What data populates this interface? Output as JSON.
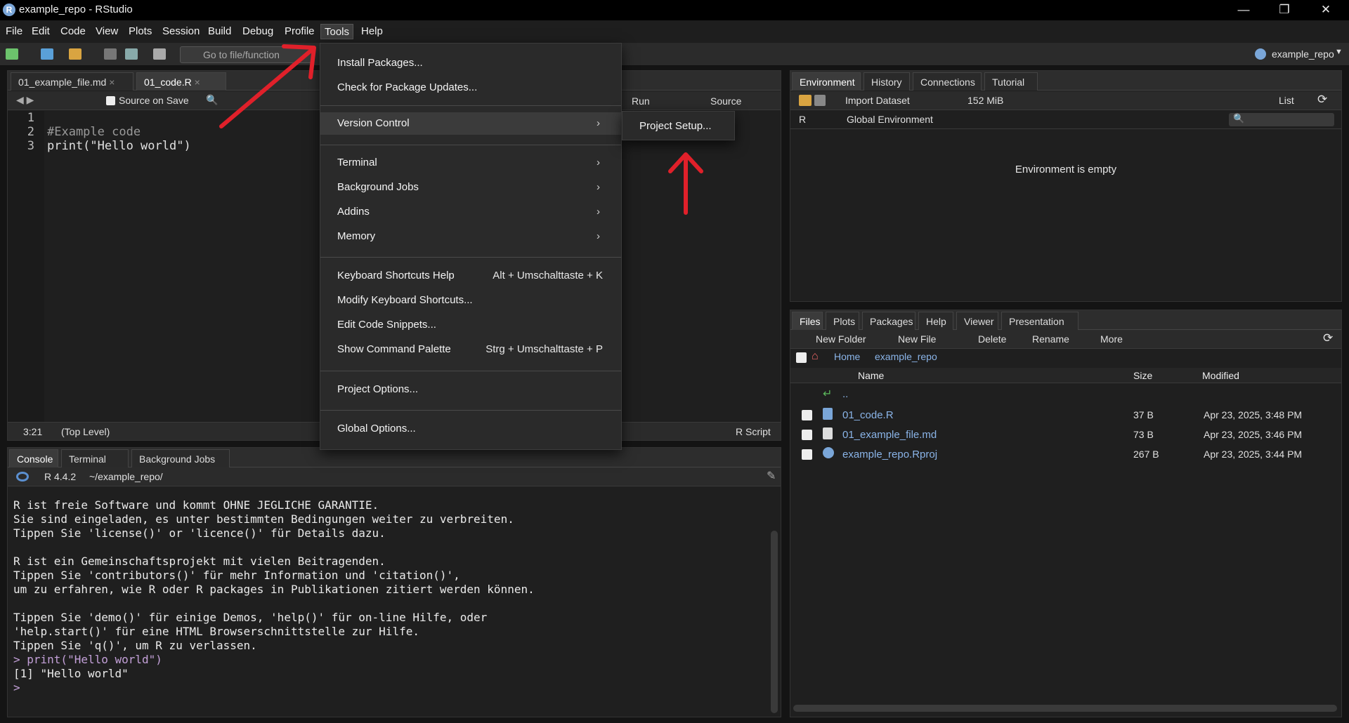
{
  "window": {
    "title": "example_repo - RStudio",
    "logo": "R"
  },
  "menubar": [
    "File",
    "Edit",
    "Code",
    "View",
    "Plots",
    "Session",
    "Build",
    "Debug",
    "Profile",
    "Tools",
    "Help"
  ],
  "toolbar": {
    "goto_placeholder": "Go to file/function",
    "project": "example_repo"
  },
  "editor": {
    "tabs": [
      "01_example_file.md",
      "01_code.R"
    ],
    "source_on_save": "Source on Save",
    "run": "Run",
    "source": "Source",
    "line_numbers": [
      "1",
      "2",
      "3"
    ],
    "lines": [
      "",
      "#Example code",
      "print(\"Hello world\")"
    ],
    "status_pos": "3:21",
    "status_scope": "(Top Level)",
    "status_type": "R Script"
  },
  "tools_menu": {
    "items": [
      {
        "label": "Install Packages..."
      },
      {
        "label": "Check for Package Updates..."
      },
      {
        "label": "Version Control"
      },
      {
        "label": "Terminal"
      },
      {
        "label": "Background Jobs"
      },
      {
        "label": "Addins"
      },
      {
        "label": "Memory"
      },
      {
        "label": "Keyboard Shortcuts Help",
        "shortcut": "Alt + Umschalttaste + K"
      },
      {
        "label": "Modify Keyboard Shortcuts..."
      },
      {
        "label": "Edit Code Snippets..."
      },
      {
        "label": "Show Command Palette",
        "shortcut": "Strg + Umschalttaste + P"
      },
      {
        "label": "Project Options..."
      },
      {
        "label": "Global Options..."
      }
    ],
    "submenu_item": "Project Setup..."
  },
  "console": {
    "tabs": [
      "Console",
      "Terminal",
      "Background Jobs"
    ],
    "version": "R 4.4.2",
    "path": "~/example_repo/",
    "text": "R ist freie Software und kommt OHNE JEGLICHE GARANTIE.\nSie sind eingeladen, es unter bestimmten Bedingungen weiter zu verbreiten.\nTippen Sie 'license()' or 'licence()' für Details dazu.\n\nR ist ein Gemeinschaftsprojekt mit vielen Beitragenden.\nTippen Sie 'contributors()' für mehr Information und 'citation()',\num zu erfahren, wie R oder R packages in Publikationen zitiert werden können.\n\nTippen Sie 'demo()' für einige Demos, 'help()' für on-line Hilfe, oder\n'help.start()' für eine HTML Browserschnittstelle zur Hilfe.\nTippen Sie 'q()', um R zu verlassen.\n",
    "cmd": "> print(\"Hello world\")",
    "out": "[1] \"Hello world\"",
    "prompt": "> "
  },
  "env": {
    "tabs": [
      "Environment",
      "History",
      "Connections",
      "Tutorial"
    ],
    "import": "Import Dataset",
    "memory": "152 MiB",
    "list": "List",
    "lang": "R",
    "scope": "Global Environment",
    "empty": "Environment is empty"
  },
  "files": {
    "tabs": [
      "Files",
      "Plots",
      "Packages",
      "Help",
      "Viewer",
      "Presentation"
    ],
    "new_folder": "New Folder",
    "new_file": "New File",
    "delete": "Delete",
    "rename": "Rename",
    "more": "More",
    "crumb_home": "Home",
    "crumb_repo": "example_repo",
    "col_name": "Name",
    "col_size": "Size",
    "col_modified": "Modified",
    "up": "..",
    "rows": [
      {
        "name": "01_code.R",
        "size": "37 B",
        "modified": "Apr 23, 2025, 3:48 PM"
      },
      {
        "name": "01_example_file.md",
        "size": "73 B",
        "modified": "Apr 23, 2025, 3:46 PM"
      },
      {
        "name": "example_repo.Rproj",
        "size": "267 B",
        "modified": "Apr 23, 2025, 3:44 PM"
      }
    ]
  }
}
